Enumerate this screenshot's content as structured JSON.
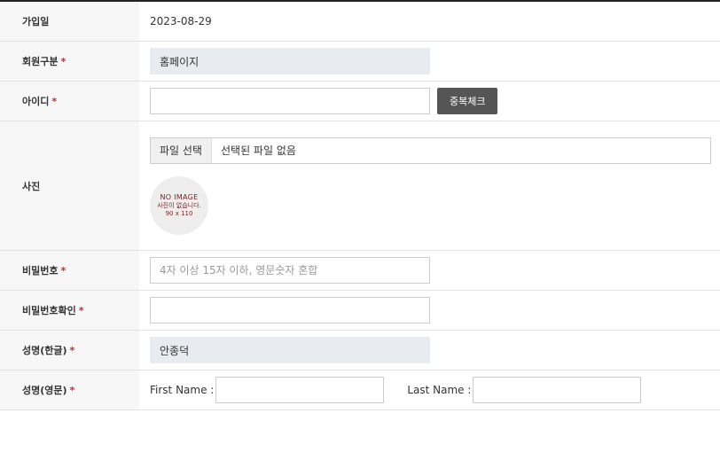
{
  "form": {
    "join_date": {
      "label": "가입일",
      "value": "2023-08-29"
    },
    "member_type": {
      "label": "회원구분",
      "required_mark": "*",
      "value": "홈페이지"
    },
    "user_id": {
      "label": "아이디",
      "required_mark": "*",
      "value": "",
      "check_button": "중복체크"
    },
    "photo": {
      "label": "사진",
      "file_button": "파일 선택",
      "file_status": "선택된 파일 없음",
      "placeholder_line1": "NO IMAGE",
      "placeholder_line2": "사진이 없습니다.",
      "placeholder_line3": "90 x 110"
    },
    "password": {
      "label": "비밀번호",
      "required_mark": "*",
      "placeholder": "4자 이상 15자 이하, 영문숫자 혼합"
    },
    "password_confirm": {
      "label": "비밀번호확인",
      "required_mark": "*",
      "value": ""
    },
    "name_korean": {
      "label": "성명(한글)",
      "required_mark": "*",
      "value": "안종덕"
    },
    "name_english": {
      "label": "성명(영문)",
      "required_mark": "*",
      "first_name_label": "First Name :",
      "last_name_label": "Last Name :",
      "first_value": "",
      "last_value": ""
    }
  },
  "colors": {
    "header_border": "#222222",
    "label_bg": "#f7f7f7",
    "required": "#e02020",
    "readonly_bg": "#e8ecf0",
    "button_bg": "#555555",
    "noimage_text": "#7a1f1f"
  }
}
